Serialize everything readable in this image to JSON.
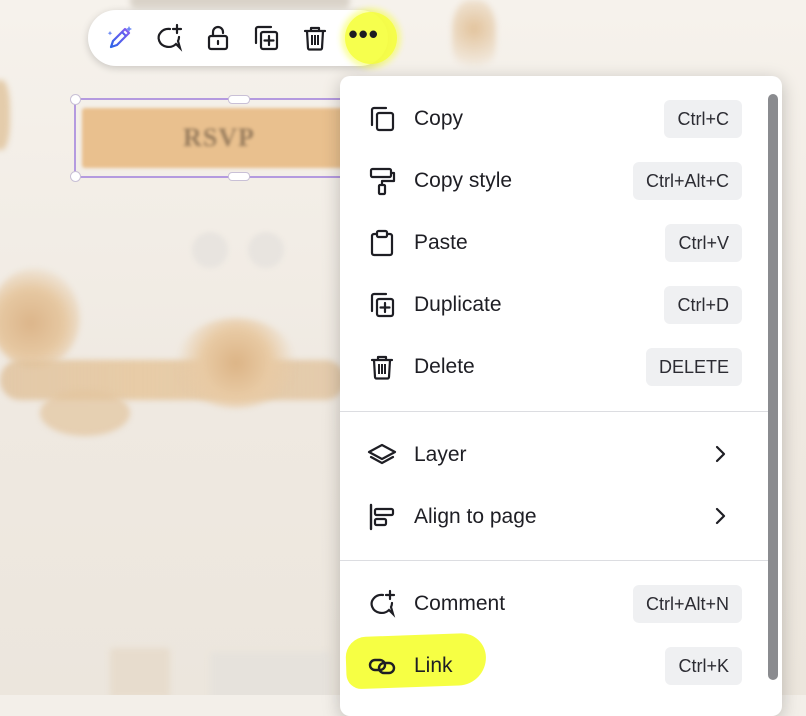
{
  "canvas": {
    "rsvp_text": "RSVP"
  },
  "toolbar": {
    "buttons": [
      {
        "name": "magic-edit",
        "icon": "magic-pencil-icon"
      },
      {
        "name": "add-comment",
        "icon": "comment-plus-icon"
      },
      {
        "name": "lock",
        "icon": "lock-icon"
      },
      {
        "name": "duplicate",
        "icon": "duplicate-icon"
      },
      {
        "name": "delete",
        "icon": "trash-icon"
      },
      {
        "name": "more",
        "icon": "more-dots-icon",
        "label": "•••",
        "highlighted": true
      }
    ],
    "highlight_color": "#f6ff3a"
  },
  "menu": {
    "items": [
      {
        "label": "Copy",
        "shortcut": "Ctrl+C",
        "icon": "copy-icon"
      },
      {
        "label": "Copy style",
        "shortcut": "Ctrl+Alt+C",
        "icon": "paint-roller-icon"
      },
      {
        "label": "Paste",
        "shortcut": "Ctrl+V",
        "icon": "clipboard-icon"
      },
      {
        "label": "Duplicate",
        "shortcut": "Ctrl+D",
        "icon": "duplicate-icon"
      },
      {
        "label": "Delete",
        "shortcut": "DELETE",
        "icon": "trash-icon"
      },
      {
        "label": "Layer",
        "icon": "layers-icon",
        "submenu": true
      },
      {
        "label": "Align to page",
        "icon": "align-left-icon",
        "submenu": true
      },
      {
        "label": "Comment",
        "shortcut": "Ctrl+Alt+N",
        "icon": "comment-plus-icon"
      },
      {
        "label": "Link",
        "shortcut": "Ctrl+K",
        "icon": "link-icon",
        "highlighted": true
      }
    ]
  }
}
